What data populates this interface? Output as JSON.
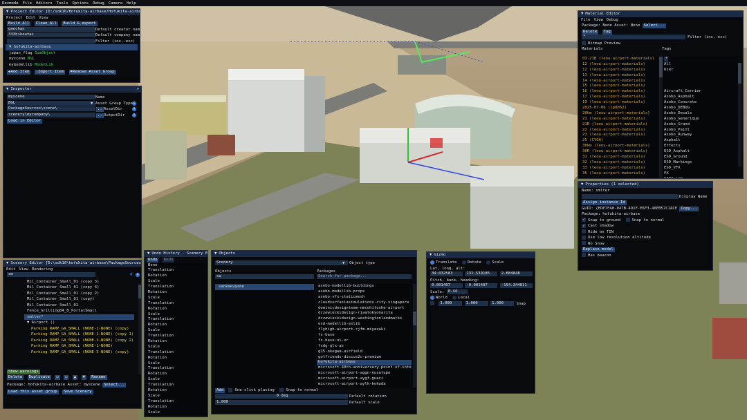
{
  "menubar": [
    "Devmode",
    "File",
    "Editors",
    "Tools",
    "Options",
    "Debug",
    "Camera",
    "Help"
  ],
  "project_editor": {
    "title": "Project Editor [D:/sdk16/Hofukita-airbase/Hofukita-airbase.x",
    "menu": [
      "Project",
      "Edit",
      "View"
    ],
    "buttons": [
      "Build All",
      "Clean All",
      "Build & export"
    ],
    "fields": [
      {
        "value": "gaochan",
        "label": "Default creator name"
      },
      {
        "value": "333hikoutai",
        "label": "Default company name"
      },
      {
        "value": "",
        "label": "Filter (inc,-exc)"
      }
    ],
    "tree": [
      "▼ hofukita-airbase",
      "japan_flag",
      "SimObject",
      "myscene",
      "BGL",
      "mymodellib",
      "ModelLib"
    ],
    "actions": [
      "Add Item",
      "Import Item",
      "Remove Asset Group"
    ]
  },
  "inspector": {
    "title": "Inspector",
    "rows": [
      {
        "value": "myscene",
        "label": "Name"
      },
      {
        "value": "BGL",
        "label": "Asset Group Type"
      },
      {
        "value": "PackageSources\\scene\\",
        "label": "AssetDir"
      },
      {
        "value": "scenery\\mycompany\\",
        "label": "OutputDir"
      }
    ],
    "load": "Load in Editor"
  },
  "scenery_editor": {
    "title": "Scenery Editor [D:\\sdk16\\hofukita-airbase\\PackageSources\\sce",
    "menu": [
      "Edit",
      "View",
      "Rendering"
    ],
    "search": "sm",
    "items": [
      {
        "text": "Mil_Container_Small_01 (copy 3)",
        "style": "white"
      },
      {
        "text": "Mil_Container_Small_01 (copy 4)",
        "style": "white"
      },
      {
        "text": "Mil_Container_Small_01 (copy 2)",
        "style": "white"
      },
      {
        "text": "Mil_Container_Small_01 (copy)",
        "style": "white"
      },
      {
        "text": "Mil_Container_Small_01",
        "style": "white"
      },
      {
        "text": "Fence_Grilling04_B_PortalSmall",
        "style": "white"
      },
      {
        "text": "smlter*",
        "style": "sel"
      },
      {
        "text": "▼ Airport  ()",
        "style": "white"
      },
      {
        "text": "Parking RAMP_GA_SMALL (NONE-1-NONE) (copy)",
        "style": "yellow"
      },
      {
        "text": "Parking RAMP_GA_SMALL (NONE-1-NONE) (copy 1)",
        "style": "yellow"
      },
      {
        "text": "Parking RAMP_GA_SMALL (NONE-1-NONE) (copy 2)",
        "style": "yellow"
      },
      {
        "text": "Parking RAMP_GA_SMALL (NONE-1-NONE)",
        "style": "yellow"
      },
      {
        "text": "Parking RAMP_GA_SMALL (NONE-5-NONE) (copy)",
        "style": "yellow"
      }
    ],
    "show_warnings": "Show warnings",
    "delete": "Delete",
    "duplicate": "Duplicate",
    "rename": "Rename",
    "package_label": "Package:",
    "package_value": "hofukita-airbase",
    "asset_label": "Asset:",
    "asset_value": "myscene",
    "select": "Select...",
    "load_group": "Load this asset group",
    "save": "Save Scenery"
  },
  "undo": {
    "title": "Undo History - Scenery Ed",
    "tabs": [
      "Undo",
      "Redo"
    ],
    "items": [
      "None",
      "Translation",
      "Rotation",
      "Scale",
      "Translation",
      "Rotation",
      "Scale",
      "Translation",
      "Rotation",
      "Scale",
      "Translation",
      "Rotation",
      "Scale",
      "Translation",
      "Rotation",
      "Scale",
      "Translation",
      "Rotation",
      "Scale",
      "Translation",
      "Rotation",
      "Scale",
      "Translation",
      "Rotation",
      "Scale",
      "Translation",
      "Rotation",
      "Scale"
    ]
  },
  "objects": {
    "title": "Objects",
    "type_value": "Scenery",
    "type_label": "Object type",
    "objects_label": "Objects",
    "packages_label": "Packages",
    "search_value": "sa",
    "package_search_placeholder": "Search for package...",
    "objects_list": [
      "sankakuyane"
    ],
    "packages": [
      "asobo-modellib-buildings",
      "asobo-modellib-props",
      "asobo-vfx-staticmesh",
      "cloudsurfasiasimulations-city-singapore",
      "dominicdesignteam-nmcohitoshe-airport",
      "drzewieckidesign-rjaatokyonarita",
      "drzewieckidesign-washingtonlandmarks",
      "esd-modellib-eslib",
      "flyhigh-airport-rjfm-miyazaki",
      "fs-base",
      "fs-base-ui-vr",
      "fsdg-glx-as",
      "g15-okegwa-airfield",
      "gotfriends-discus2c-premium",
      "hofukita-airbase",
      "microsoft-40th-anniversary-point-of-interest",
      "microsoft-airport-aggn-nusatupe",
      "microsoft-airport-aygf-guari",
      "microsoft-airport-aylk-kokoda"
    ],
    "add": "Add",
    "one_click": "One-click placing",
    "snap": "Snap to normal",
    "rotation_value": "0 deg",
    "rotation_label": "Default rotation",
    "scale_value": "1.000",
    "scale_label": "Default scale"
  },
  "gizmo": {
    "title": "Gizmo",
    "modes": [
      "Translate",
      "Rotate",
      "Scale"
    ],
    "latlon_label": "Lat, long, alt:",
    "latlon": [
      "34.032583",
      "131.539185",
      "2.884848"
    ],
    "pbh_label": "Pitch, bank, heading:",
    "pbh": [
      "0.001407",
      "-0.001407",
      "-154.344811"
    ],
    "scale_label": "Scale:",
    "scale_value": "0.44",
    "space": [
      "World",
      "Local"
    ],
    "snap_values": [
      "1.000",
      "1.000",
      "1.000"
    ],
    "snap_label": "Snap"
  },
  "material_editor": {
    "title": "Material Editor",
    "menu": [
      "File",
      "View",
      "Debug"
    ],
    "package_label": "Package:",
    "package_value": "None",
    "asset_label": "Asset:",
    "asset_value": "None",
    "select": "Select...",
    "delete": "Delete",
    "tag": "Tag",
    "filter_label": "Filter (inc,-exc)",
    "bitmap": "Bitmap Preview",
    "materials_label": "Materials",
    "tags_label": "Tags",
    "materials": [
      "03-21B (leou-airport-materials)",
      "12 (leou-airport-materials)",
      "12 (leou-airport-materials)",
      "13 (leou-airport-materials)",
      "14 (leou-airport-materials)",
      "15 (leou-airport-materials)",
      "16 (leou-airport-materials)",
      "17 (leou-airport-materials)",
      "19 (leou-airport-materials)",
      "2025-07-06 (ip8052)",
      "20km (leou-airport-materials)",
      "21 (leou-airport-materials)",
      "21B (leou-airport-materials)",
      "22 (leou-airport-materials)",
      "23 (leou-airport-materials)",
      "25 (CYOA)",
      "30km (leou-airport-materials)",
      "30R (leou-airport-materials)",
      "31 (leou-airport-materials)",
      "32 (leou-airport-materials)",
      "33 (leou-airport-materials)",
      "35 (leou-airport-materials)"
    ],
    "tags": [
      "All",
      "User",
      "",
      "",
      "",
      "Aircraft_Carrier",
      "Asobo_Asphalt",
      "Asobo_Concrete",
      "Asobo_DEBUG",
      "Asobo_Decals",
      "Asobo_Generique",
      "Asobo_Grand",
      "Asobo_Paint",
      "Asobo_Runway",
      "Asphalt",
      "Effects",
      "ESD_Asphalt",
      "ESD_Ground",
      "ESD_Markings",
      "ESD_VFX",
      "FX",
      "GAYA_Lib"
    ]
  },
  "properties": {
    "title": "Properties (1 selected)",
    "name_label": "Name",
    "name_value": "smlter",
    "display_label": "Display Name",
    "assign": "Assign instance Id",
    "guid": "GUID: {EDE7FA8-047B-491F-E6F3-46EB57C1ACE",
    "copy": "Copy...",
    "package": "Package: hofukita-airbase",
    "checks": [
      {
        "label": "Snap to ground",
        "on": true
      },
      {
        "label": "Snap to normal",
        "on": false
      },
      {
        "label": "Cast shadow",
        "on": true
      },
      {
        "label": "Hide on TIN",
        "on": false
      },
      {
        "label": "Use low resolution altitude",
        "on": false
      },
      {
        "label": "No Snow",
        "on": false
      }
    ],
    "replace": "Replace model",
    "beacon": "Has beacon"
  }
}
